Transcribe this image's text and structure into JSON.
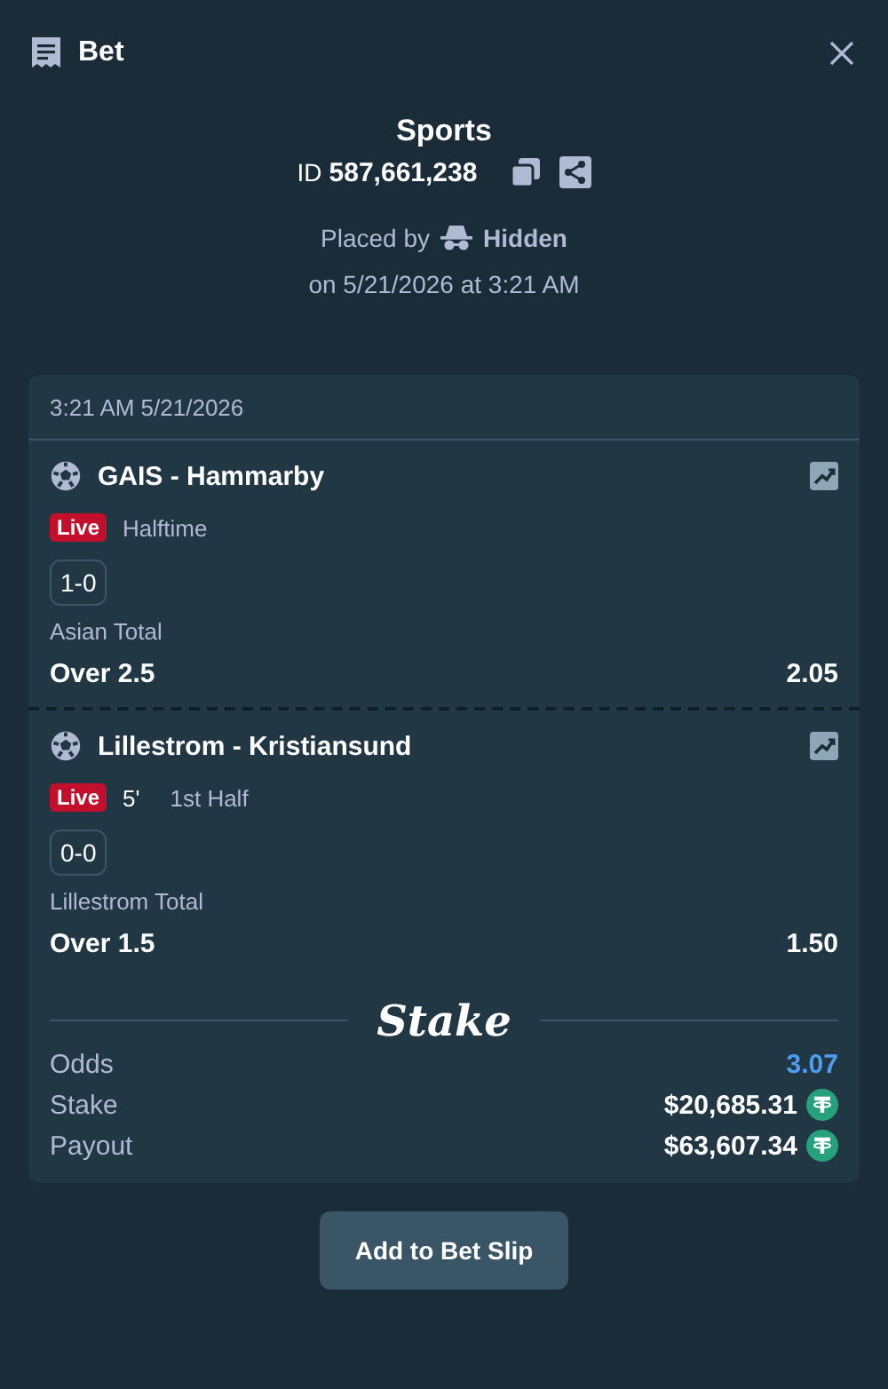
{
  "header": {
    "title": "Bet"
  },
  "summary": {
    "category": "Sports",
    "id_label": "ID",
    "id_value": "587,661,238",
    "placed_by_label": "Placed by",
    "placed_by_user": "Hidden",
    "placed_on": "on 5/21/2026 at 3:21 AM"
  },
  "card": {
    "timestamp": "3:21 AM 5/21/2026",
    "legs": [
      {
        "match": "GAIS - Hammarby",
        "live_badge": "Live",
        "period": "Halftime",
        "score": "1-0",
        "market": "Asian Total",
        "selection": "Over 2.5",
        "odds": "2.05"
      },
      {
        "match": "Lillestrom - Kristiansund",
        "live_badge": "Live",
        "minute": "5'",
        "period": "1st Half",
        "score": "0-0",
        "market": "Lillestrom Total",
        "selection": "Over 1.5",
        "odds": "1.50"
      }
    ],
    "logo": "Stake",
    "totals": [
      {
        "kind": "odds",
        "label": "Odds",
        "value": "3.07"
      },
      {
        "kind": "amount",
        "label": "Stake",
        "value": "$20,685.31"
      },
      {
        "kind": "amount",
        "label": "Payout",
        "value": "$63,607.34"
      }
    ]
  },
  "button": "Add to Bet Slip"
}
